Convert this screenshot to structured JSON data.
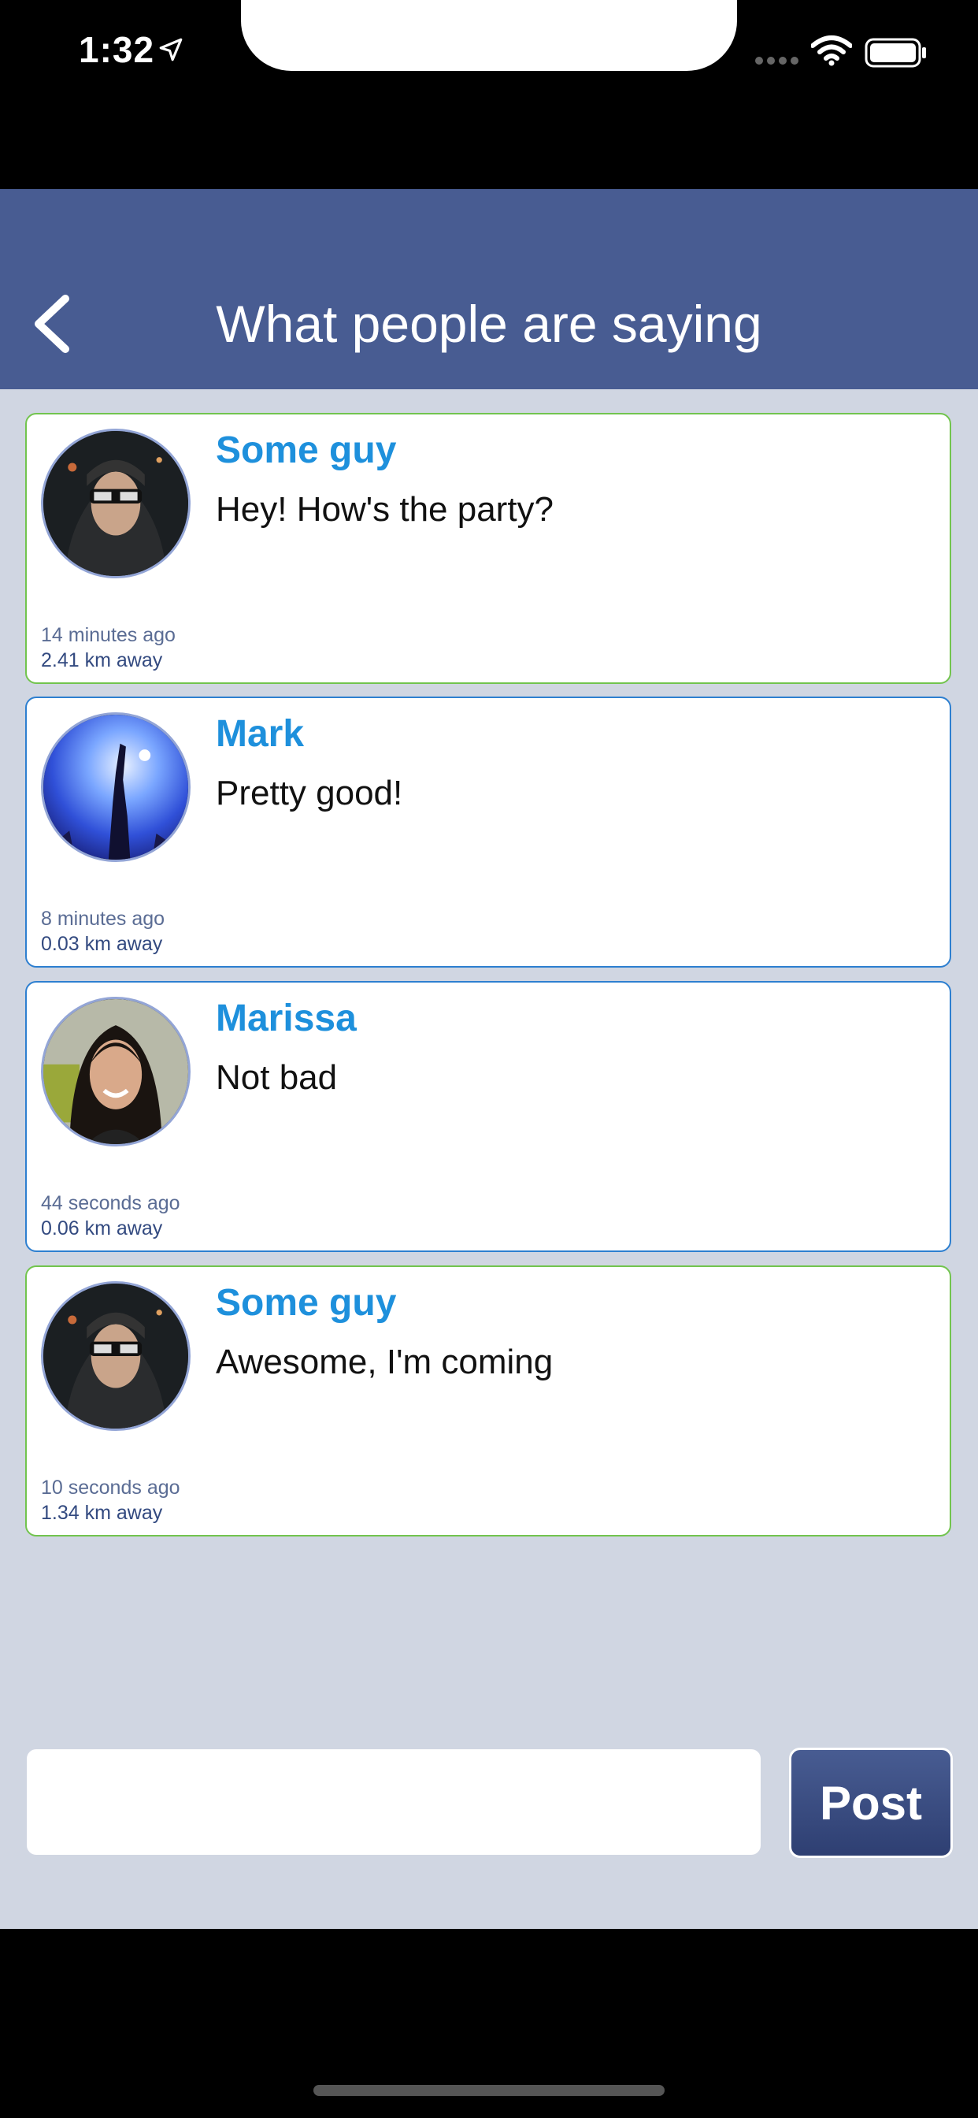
{
  "status_bar": {
    "time": "1:32",
    "icons": [
      "location-arrow-icon",
      "signal-icon",
      "wifi-icon",
      "battery-icon"
    ]
  },
  "nav": {
    "title": "What people are saying",
    "back_icon": "chevron-left-icon"
  },
  "messages": [
    {
      "name": "Some guy",
      "text": "Hey! How's the party?",
      "time": "14 minutes ago",
      "distance": "2.41 km away",
      "border_color": "#72c44e"
    },
    {
      "name": "Mark",
      "text": "Pretty good!",
      "time": "8 minutes ago",
      "distance": "0.03 km away",
      "border_color": "#2d7fd0"
    },
    {
      "name": "Marissa",
      "text": "Not bad",
      "time": "44 seconds ago",
      "distance": "0.06 km away",
      "border_color": "#2d7fd0"
    },
    {
      "name": "Some guy",
      "text": "Awesome, I'm coming",
      "time": "10 seconds ago",
      "distance": "1.34 km away",
      "border_color": "#72c44e"
    }
  ],
  "composer": {
    "input_value": "",
    "post_label": "Post"
  },
  "colors": {
    "nav_bg": "#485c92",
    "screen_bg": "#d0d6e2",
    "name_color": "#1e90dc"
  }
}
